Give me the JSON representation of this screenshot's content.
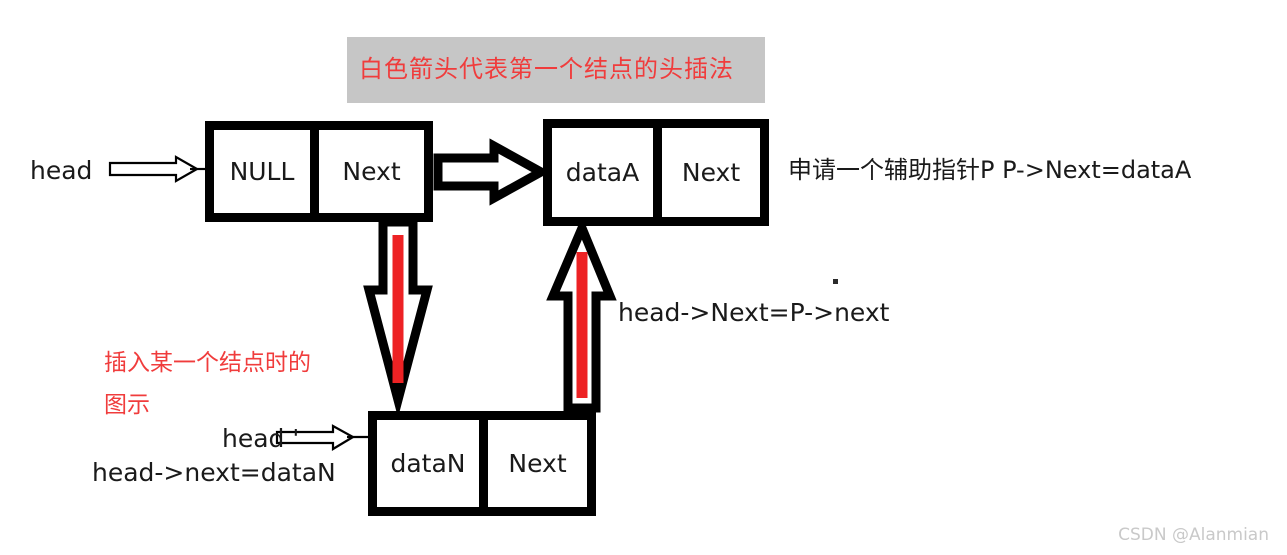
{
  "banner": {
    "text": "白色箭头代表第一个结点的头插法",
    "background": "#c6c6c6",
    "text_color": "#f03c3c"
  },
  "nodes": [
    {
      "id": "head-node",
      "data_label": "NULL",
      "next_label": "Next"
    },
    {
      "id": "node-a",
      "data_label": "dataA",
      "next_label": "Next"
    },
    {
      "id": "node-n",
      "data_label": "dataN",
      "next_label": "Next"
    }
  ],
  "pointers": {
    "head": "head",
    "head_prime": "head '"
  },
  "annotations": {
    "apply_pointer": "申请一个辅助指针P  P->Next=dataA",
    "head_next_p_next": "head->Next=P->next",
    "head_next_datan": "head->next=dataN",
    "red_note_line1": "插入某一个结点时的",
    "red_note_line2": "图示"
  },
  "colors": {
    "red_accent": "#ed2224",
    "red_text": "#f03c3c",
    "outline": "#000000",
    "banner_gray": "#c6c6c6",
    "watermark_gray": "#c9c9c9"
  },
  "watermark": "CSDN @Alanmian"
}
